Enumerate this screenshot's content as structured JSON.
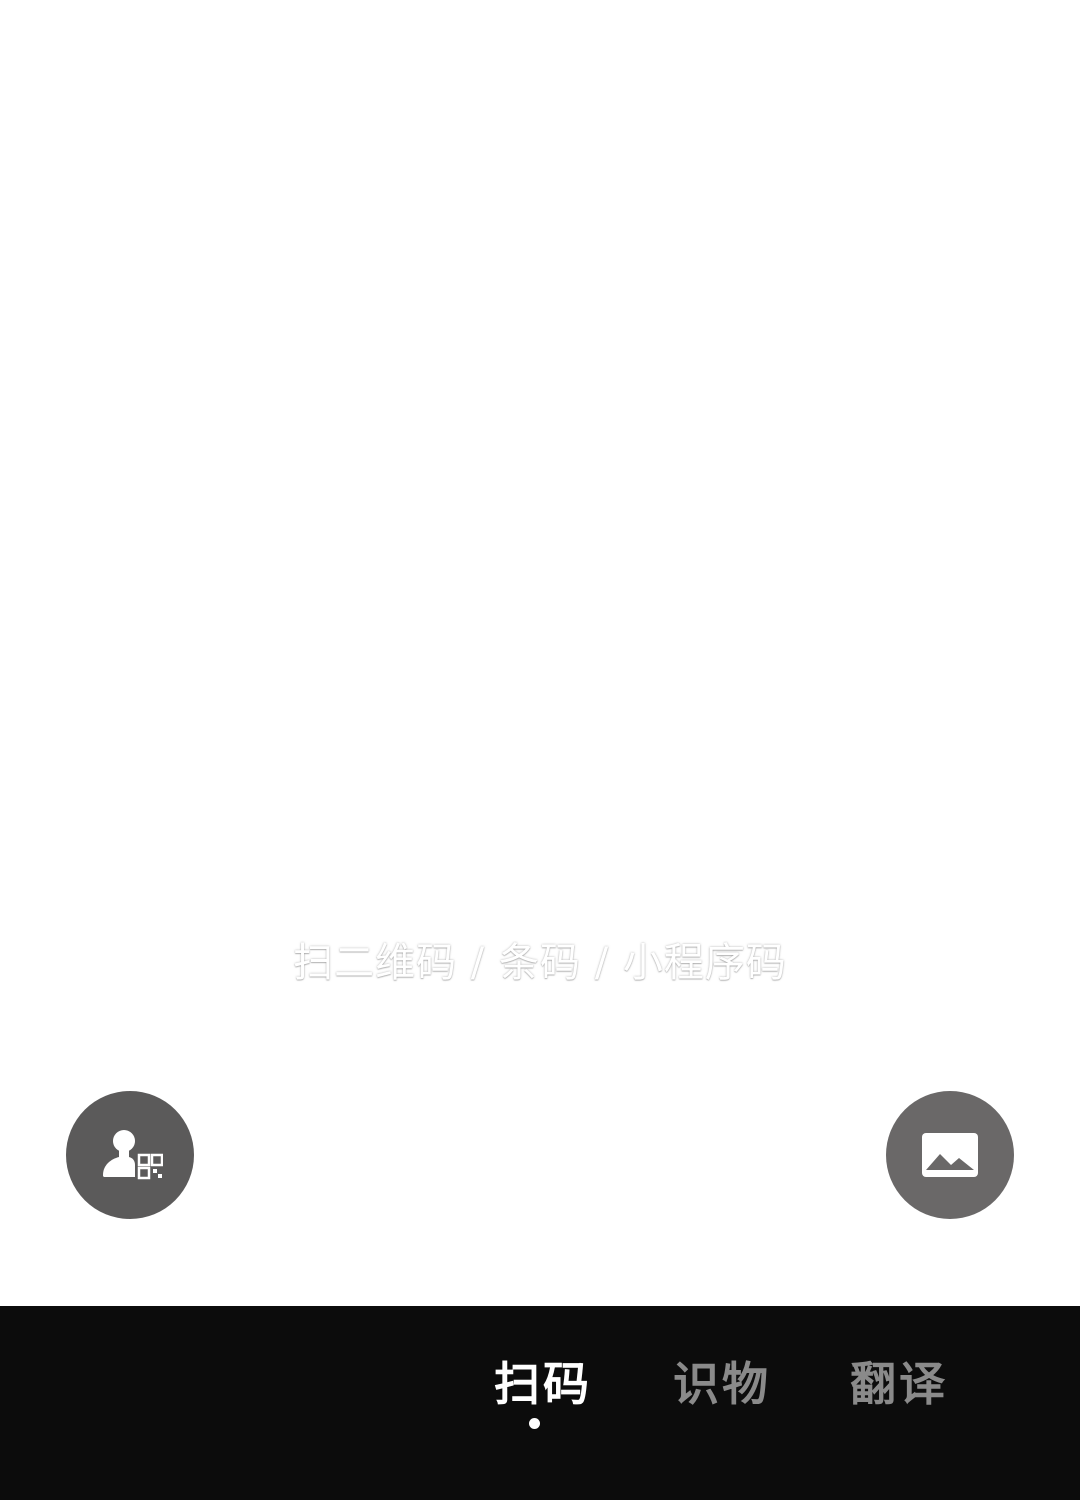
{
  "scan_hint": "扫二维码 / 条码 / 小程序码",
  "buttons": {
    "my_qr_icon": "person-qr-icon",
    "album_icon": "image-icon"
  },
  "tabs": [
    {
      "label": "扫码",
      "active": true
    },
    {
      "label": "识物",
      "active": false
    },
    {
      "label": "翻译",
      "active": false
    }
  ],
  "colors": {
    "bottom_bar": "#0c0c0c",
    "button_bg": "#5b5a5a",
    "active_tab": "#ffffff",
    "inactive_tab": "#8a8a8a"
  }
}
